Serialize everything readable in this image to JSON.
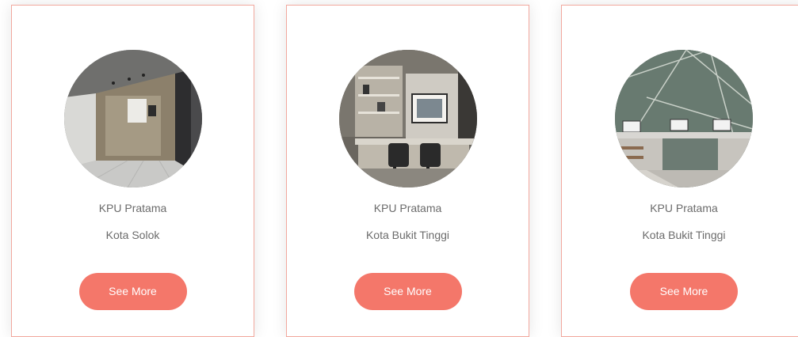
{
  "cards": [
    {
      "title": "KPU Pratama",
      "city": "Kota Solok",
      "button_label": "See More"
    },
    {
      "title": "KPU Pratama",
      "city": "Kota Bukit Tinggi",
      "button_label": "See More"
    },
    {
      "title": "KPU Pratama",
      "city": "Kota Bukit Tinggi",
      "button_label": "See More"
    }
  ],
  "colors": {
    "accent": "#f4776a",
    "card_border": "#f2a89e",
    "text": "#6b6b6b"
  }
}
